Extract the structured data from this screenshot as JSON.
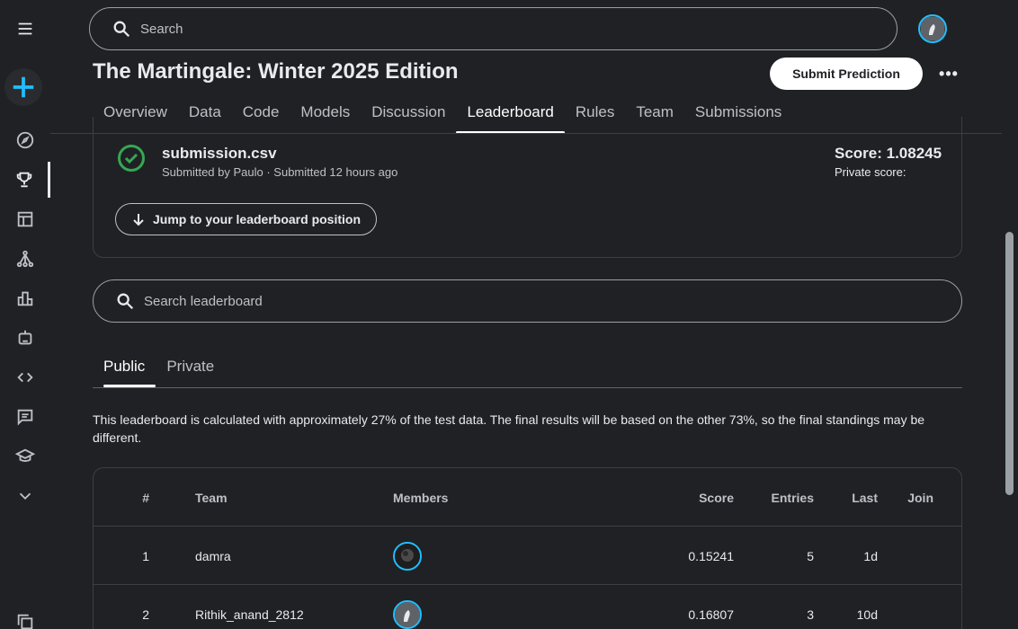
{
  "header": {
    "search_placeholder": "Search",
    "title": "The Martingale: Winter 2025 Edition",
    "submit_label": "Submit Prediction",
    "more_label": "•••"
  },
  "sidebar": {
    "icons": [
      "menu-icon",
      "create-icon",
      "explore-icon",
      "competitions-icon",
      "datasets-icon",
      "models-icon",
      "leaderboard-chart-icon",
      "robot-icon",
      "code-icon",
      "discussion-icon",
      "learn-icon",
      "chevron-down-icon",
      "copy-icon"
    ]
  },
  "tabs": [
    "Overview",
    "Data",
    "Code",
    "Models",
    "Discussion",
    "Leaderboard",
    "Rules",
    "Team",
    "Submissions"
  ],
  "active_tab": "Leaderboard",
  "submission": {
    "filename": "submission.csv",
    "meta": "Submitted by Paulo · Submitted 12 hours ago",
    "score": "Score: 1.08245",
    "private_score": "Private score:",
    "jump_label": "Jump to your leaderboard position"
  },
  "leaderboard_search_placeholder": "Search leaderboard",
  "subtabs": [
    "Public",
    "Private"
  ],
  "note": "This leaderboard is calculated with approximately 27% of the test data. The final results will be based on the other 73%, so the final standings may be different.",
  "table": {
    "headers": {
      "rank": "#",
      "team": "Team",
      "members": "Members",
      "score": "Score",
      "entries": "Entries",
      "last": "Last",
      "join": "Join"
    },
    "rows": [
      {
        "rank": "1",
        "team": "damra",
        "score": "0.15241",
        "entries": "5",
        "last": "1d"
      },
      {
        "rank": "2",
        "team": "Rithik_anand_2812",
        "score": "0.16807",
        "entries": "3",
        "last": "10d"
      }
    ]
  },
  "colors": {
    "background": "#202124",
    "accent": "#20beff",
    "success": "#34a853"
  }
}
